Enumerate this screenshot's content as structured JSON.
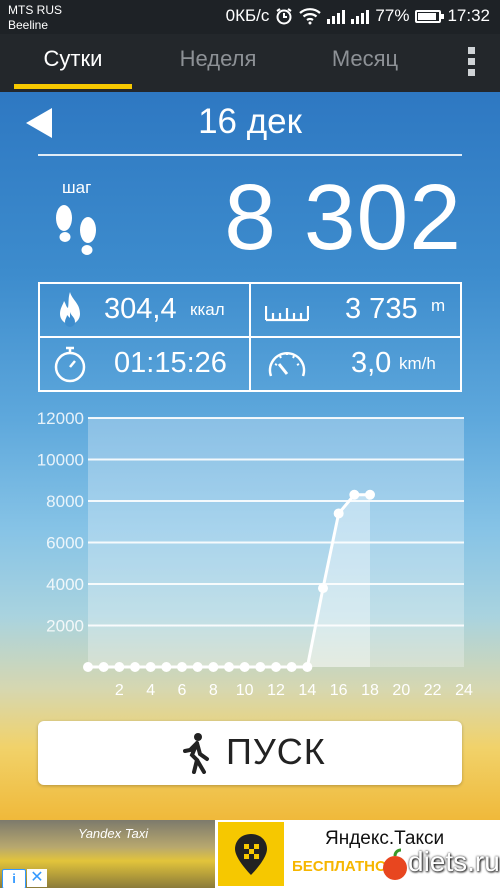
{
  "status_bar": {
    "carrier_1": "MTS RUS",
    "carrier_2": "Beeline",
    "network_speed": "0КБ/с",
    "battery_percent": "77%",
    "time": "17:32"
  },
  "tabs": [
    {
      "label": "Сутки",
      "active": true
    },
    {
      "label": "Неделя",
      "active": false
    },
    {
      "label": "Месяц",
      "active": false
    }
  ],
  "date": "16 дек",
  "steps": {
    "label": "шаг",
    "value": "8 302"
  },
  "stats": {
    "calories": {
      "value": "304,4",
      "unit": "ккал"
    },
    "distance": {
      "value": "3 735",
      "unit": "m"
    },
    "duration": {
      "value": "01:15:26"
    },
    "speed": {
      "value": "3,0",
      "unit": "km/h"
    }
  },
  "chart_data": {
    "type": "area",
    "x": [
      0,
      1,
      2,
      3,
      4,
      5,
      6,
      7,
      8,
      9,
      10,
      11,
      12,
      13,
      14,
      15,
      16,
      17,
      18
    ],
    "values": [
      0,
      0,
      0,
      0,
      0,
      0,
      0,
      0,
      0,
      0,
      0,
      0,
      0,
      0,
      0,
      3800,
      7400,
      8300,
      8300
    ],
    "x_ticks": [
      "2",
      "4",
      "6",
      "8",
      "10",
      "12",
      "14",
      "16",
      "18",
      "20",
      "22",
      "24"
    ],
    "y_ticks": [
      "2000",
      "4000",
      "6000",
      "8000",
      "10000",
      "12000"
    ],
    "xlim": [
      0,
      24
    ],
    "ylim": [
      0,
      12000
    ],
    "grid": true
  },
  "start_button": {
    "label": "ПУСК"
  },
  "ad": {
    "photo_text": "Yandex Taxi",
    "title": "Яндекс.Такси",
    "subtitle": "БЕСПЛАТНО",
    "info_icon": "i",
    "close_icon": "✕"
  },
  "watermark": "diets.ru",
  "colors": {
    "accent": "#f6c800",
    "toolbar": "#23272b"
  }
}
